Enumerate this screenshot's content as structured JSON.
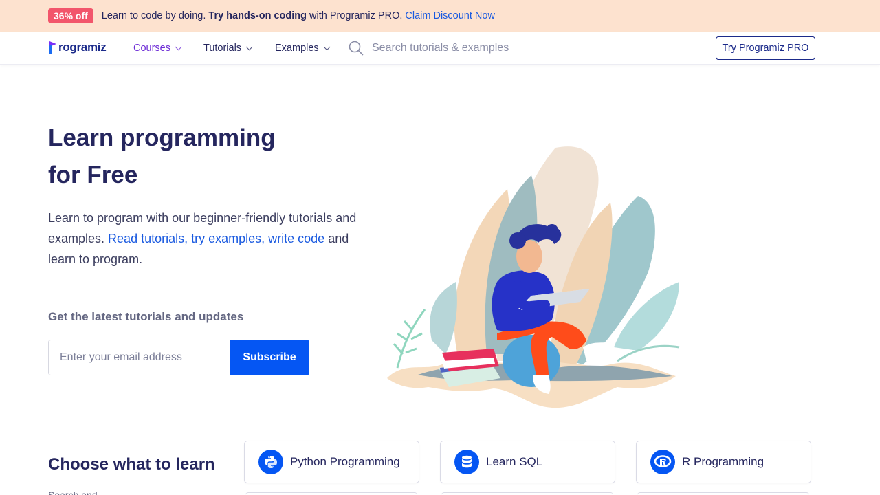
{
  "promo": {
    "badge": "36% off",
    "text_before": "Learn to code by doing. ",
    "text_bold": "Try hands-on coding",
    "text_after": " with Programiz PRO.",
    "link": "Claim Discount Now"
  },
  "nav": {
    "logo": "rogramiz",
    "items": [
      {
        "label": "Courses",
        "active": true
      },
      {
        "label": "Tutorials",
        "active": false
      },
      {
        "label": "Examples",
        "active": false
      }
    ],
    "search_placeholder": "Search tutorials & examples",
    "cta": "Try Programiz PRO"
  },
  "hero": {
    "title_line1": "Learn programming",
    "title_line2": "for Free",
    "desc_plain1": "Learn to program with our beginner-friendly tutorials and examples. ",
    "desc_link": "Read tutorials, try examples, write code",
    "desc_plain2": " and learn to program.",
    "updates_label": "Get the latest tutorials and updates",
    "email_placeholder": "Enter your email address",
    "subscribe": "Subscribe"
  },
  "choose": {
    "title": "Choose what to learn",
    "subtitle": "Search and..."
  },
  "courses": [
    {
      "label": "Python Programming",
      "icon": "python-icon"
    },
    {
      "label": "Learn SQL",
      "icon": "database-icon"
    },
    {
      "label": "R Programming",
      "icon": "r-logo-icon"
    }
  ],
  "colors": {
    "accent": "#0556f3",
    "promo_bg": "#fde2cf",
    "badge": "#f2556b",
    "heading": "#25265e",
    "active_nav": "#6d2cd6"
  }
}
